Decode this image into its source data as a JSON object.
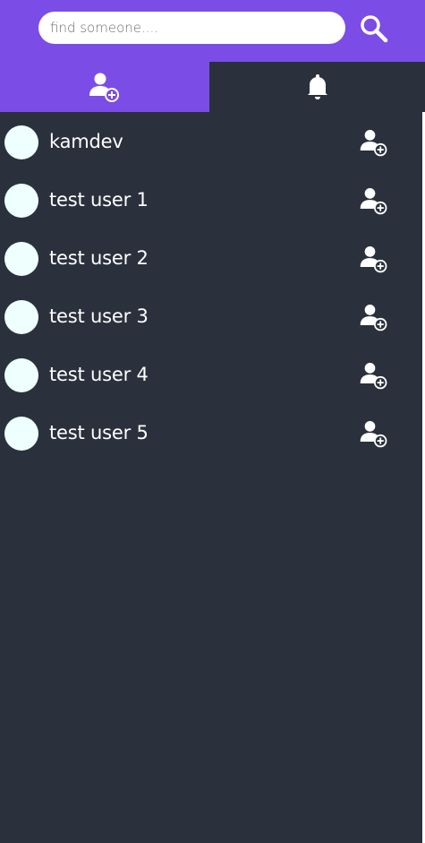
{
  "search": {
    "placeholder": "find someone....",
    "value": "",
    "button_icon": "search-icon"
  },
  "tabs": [
    {
      "icon": "add-user-icon",
      "active": true
    },
    {
      "icon": "bell-icon",
      "active": false
    }
  ],
  "users": [
    {
      "name": "kamdev",
      "action_icon": "add-user-icon"
    },
    {
      "name": "test user 1",
      "action_icon": "add-user-icon"
    },
    {
      "name": "test user 2",
      "action_icon": "add-user-icon"
    },
    {
      "name": "test user 3",
      "action_icon": "add-user-icon"
    },
    {
      "name": "test user 4",
      "action_icon": "add-user-icon"
    },
    {
      "name": "test user 5",
      "action_icon": "add-user-icon"
    }
  ],
  "colors": {
    "accent": "#7b4de6",
    "background": "#2a313c",
    "avatar": "#eefffd",
    "text": "#ffffff"
  }
}
